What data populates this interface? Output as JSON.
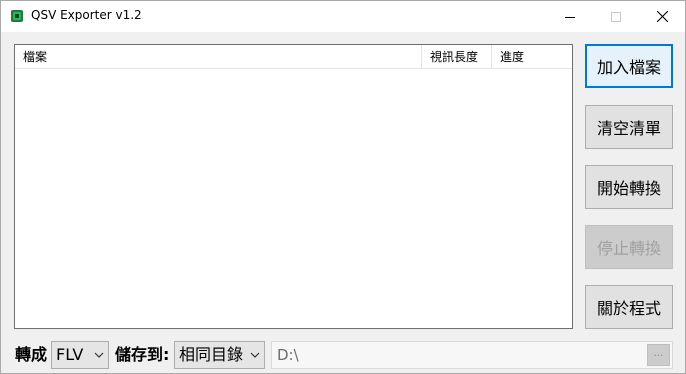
{
  "window": {
    "title": "QSV Exporter v1.2",
    "icon": "qsv-app-icon",
    "controls": {
      "minimize": "minimize-icon",
      "maximize": "maximize-icon",
      "close": "close-icon"
    }
  },
  "file_list": {
    "columns": [
      "檔案",
      "視訊長度",
      "進度"
    ],
    "rows": []
  },
  "buttons": {
    "add_files": "加入檔案",
    "clear_list": "清空清單",
    "start_convert": "開始轉換",
    "stop_convert": "停止轉換",
    "about": "關於程式"
  },
  "bottom": {
    "convert_label": "轉成",
    "format_value": "FLV",
    "save_label": "儲存到:",
    "destination_value": "相同目錄",
    "path_value": "D:\\",
    "browse_label": "..."
  },
  "colors": {
    "accent": "#0078d7",
    "disabled_text": "#a0a0a0"
  }
}
